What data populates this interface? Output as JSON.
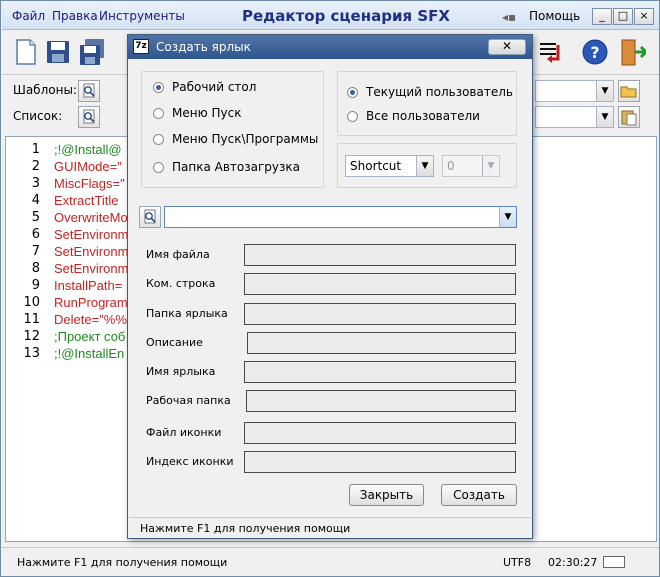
{
  "app": {
    "title": "Редактор сценария SFX",
    "menu": [
      "Файл",
      "Правка",
      "Инструменты"
    ],
    "help_menu": "Помощь",
    "window_buttons": [
      "_",
      "□",
      "×"
    ]
  },
  "rows": {
    "templates_label": "Шаблоны:",
    "list_label": "Список:"
  },
  "editor": {
    "line_numbers": [
      "1",
      "2",
      "3",
      "4",
      "5",
      "6",
      "7",
      "8",
      "9",
      "10",
      "11",
      "12",
      "13"
    ],
    "lines": [
      ";!@Install@",
      "GUIMode=\"",
      "MiscFlags=\"",
      "ExtractTitle",
      "OverwriteMo",
      "SetEnvironm",
      "SetEnvironm",
      "SetEnvironm",
      "InstallPath=",
      "RunProgram",
      "Delete=\"%%",
      ";Проект соб",
      ";!@InstallEn"
    ]
  },
  "status": {
    "hint": "Нажмите F1 для получения помощи",
    "encoding": "UTF8",
    "time": "02:30:27"
  },
  "dialog": {
    "title": "Создать ярлык",
    "close": "✕",
    "locations": [
      "Рабочий стол",
      "Меню Пуск",
      "Меню Пуск\\Программы",
      "Папка Автозагрузка"
    ],
    "users": [
      "Текущий пользователь",
      "Все пользователи"
    ],
    "shortcut_type": "Shortcut",
    "number_value": "0",
    "fields": [
      "Имя файла",
      "Ком. строка",
      "Папка ярлыка",
      "Описание",
      "Имя ярлыка",
      "Рабочая папка",
      "Файл иконки",
      "Индекс иконки"
    ],
    "close_button": "Закрыть",
    "create_button": "Создать",
    "hint": "Нажмите F1 для получения помощи"
  },
  "colors": {
    "keyword": "#cc1f1f",
    "comment": "#1f8a1f",
    "title": "#1f2f86"
  }
}
